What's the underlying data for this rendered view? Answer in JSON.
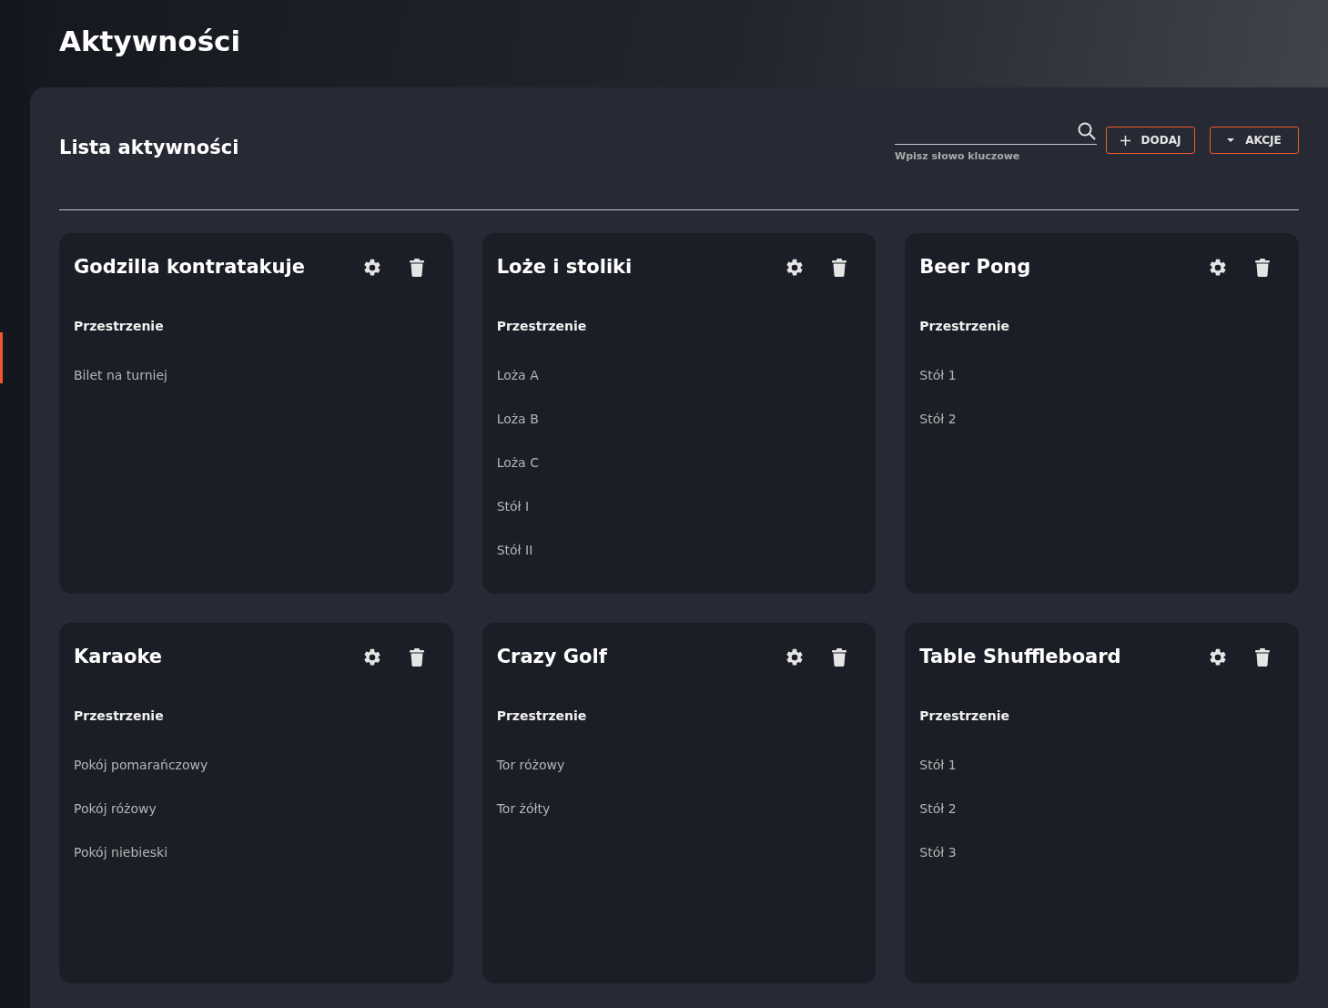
{
  "page_title": "Aktywności",
  "panel": {
    "title": "Lista aktywności",
    "search": {
      "hint": "Wpisz słowo kluczowe"
    },
    "buttons": [
      {
        "kind": "add",
        "label": "DODAJ"
      },
      {
        "kind": "menu",
        "label": "AKCJE"
      }
    ]
  },
  "cards": [
    {
      "title": "Godzilla kontratakuje",
      "section": "Przestrzenie",
      "items": [
        "Bilet na turniej"
      ]
    },
    {
      "title": "Loże i stoliki",
      "section": "Przestrzenie",
      "items": [
        "Loża A",
        "Loża B",
        "Loża C",
        "Stół I",
        "Stół II"
      ]
    },
    {
      "title": "Beer Pong",
      "section": "Przestrzenie",
      "items": [
        "Stół 1",
        "Stół 2"
      ]
    },
    {
      "title": "Karaoke",
      "section": "Przestrzenie",
      "items": [
        "Pokój pomarańczowy",
        "Pokój różowy",
        "Pokój niebieski"
      ]
    },
    {
      "title": "Crazy Golf",
      "section": "Przestrzenie",
      "items": [
        "Tor różowy",
        "Tor żółty"
      ]
    },
    {
      "title": "Table Shuffleboard",
      "section": "Przestrzenie",
      "items": [
        "Stół 1",
        "Stół 2",
        "Stół 3"
      ]
    }
  ]
}
